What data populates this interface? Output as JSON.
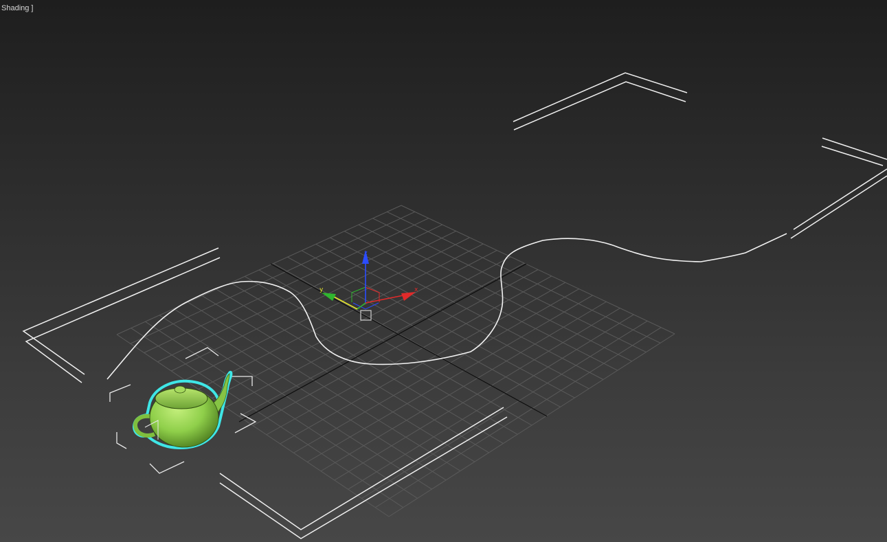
{
  "viewport": {
    "label": "Shading ]"
  },
  "gizmo": {
    "axis_x": "x",
    "axis_y": "y",
    "axis_z": "z",
    "color_x": "#e02a2a",
    "color_y": "#2fb52f",
    "color_z": "#2b4cff",
    "color_highlight": "#e6e62a"
  },
  "scene": {
    "selected_object": "teapot",
    "selection_outline_color": "#3fe6e6",
    "teapot_color": "#8fcf4a",
    "spline_color": "#f2f2f2",
    "grid_color": "#5a5a5a",
    "grid_axis_color": "#0d0d0d"
  },
  "icons": {
    "gizmo": "transform-gizmo-icon",
    "pivot": "pivot-box-icon"
  }
}
